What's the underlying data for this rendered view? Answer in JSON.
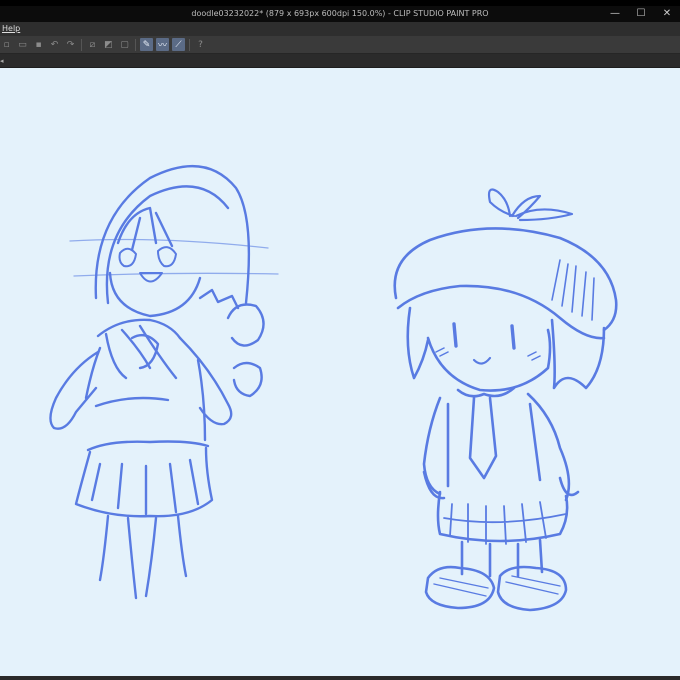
{
  "window": {
    "title": "doodle03232022* (879 x 693px 600dpi 150.0%)  - CLIP STUDIO PAINT PRO",
    "controls": {
      "minimize": "—",
      "maximize": "☐",
      "close": "✕"
    }
  },
  "menu": {
    "help_label": "Help"
  },
  "toolbar": {
    "icons": [
      "new-icon",
      "open-icon",
      "save-icon",
      "undo-icon",
      "redo-icon",
      "clear-icon",
      "fill-icon",
      "transform-icon",
      "pen-tool-icon",
      "brush-tool-icon",
      "ruler-tool-icon",
      "help-icon"
    ],
    "selected_glyph_1": "✎",
    "selected_glyph_2": "〰",
    "selected_glyph_3": "⟋",
    "help_glyph": "?"
  },
  "canvas": {
    "background": "#e4f2fb",
    "stroke_color": "#4a6fe0"
  }
}
